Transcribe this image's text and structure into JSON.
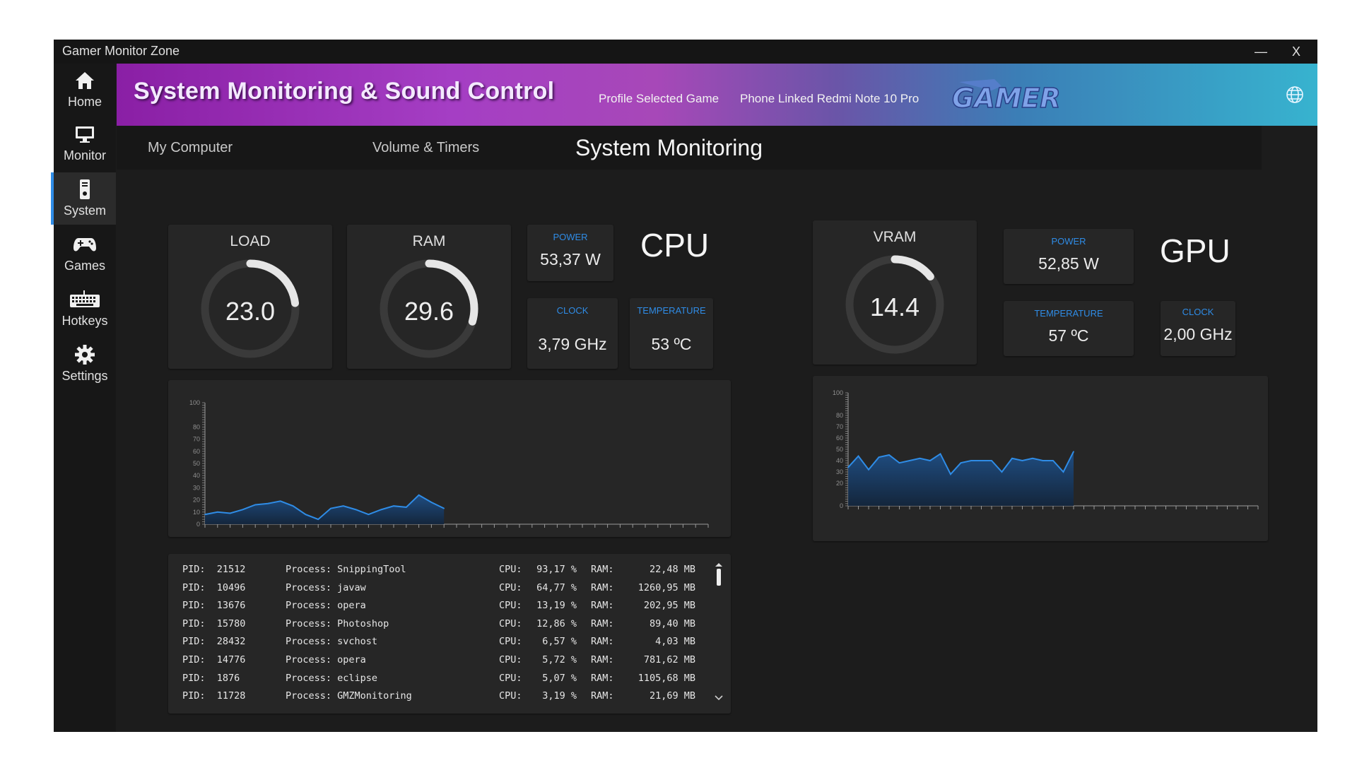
{
  "window": {
    "title": "Gamer Monitor Zone",
    "minimize": "—",
    "close": "X"
  },
  "sidebar": {
    "items": [
      {
        "label": "Home",
        "icon": "home-icon"
      },
      {
        "label": "Monitor",
        "icon": "monitor-icon"
      },
      {
        "label": "System",
        "icon": "system-icon",
        "active": true
      },
      {
        "label": "Games",
        "icon": "gamepad-icon"
      },
      {
        "label": "Hotkeys",
        "icon": "keyboard-icon"
      },
      {
        "label": "Settings",
        "icon": "gear-icon"
      }
    ]
  },
  "banner": {
    "heading": "System Monitoring & Sound Control",
    "profile": "Profile Selected Game",
    "phone": "Phone Linked Redmi Note 10 Pro",
    "logo_text": "GAMER"
  },
  "tabs": [
    {
      "label": "My Computer"
    },
    {
      "label": "Volume & Timers"
    },
    {
      "label": "System Monitoring",
      "active": true
    }
  ],
  "cpu": {
    "label": "CPU",
    "load": {
      "title": "LOAD",
      "value": "23.0",
      "fraction": 0.23
    },
    "ram": {
      "title": "RAM",
      "value": "29.6",
      "fraction": 0.296
    },
    "power": {
      "label": "POWER",
      "value": "53,37 W"
    },
    "clock": {
      "label": "CLOCK",
      "value": "3,79 GHz"
    },
    "temperature": {
      "label": "TEMPERATURE",
      "value": "53 ºC"
    }
  },
  "gpu": {
    "label": "GPU",
    "vram": {
      "title": "VRAM",
      "value": "14.4",
      "fraction": 0.144
    },
    "power": {
      "label": "POWER",
      "value": "52,85 W"
    },
    "temperature": {
      "label": "TEMPERATURE",
      "value": "57 ºC"
    },
    "clock": {
      "label": "CLOCK",
      "value": "2,00 GHz"
    }
  },
  "chart_data": [
    {
      "type": "area",
      "y_ticks": [
        "100",
        "80",
        "70",
        "60",
        "50",
        "40",
        "30",
        "20",
        "10",
        "0"
      ],
      "ylim": [
        0,
        100
      ],
      "xlim": [
        0,
        100
      ],
      "x": [
        0,
        2.5,
        5,
        7.5,
        10,
        12.5,
        15,
        17.5,
        20,
        22.5,
        25,
        27.5,
        30,
        32.5,
        35,
        37.5,
        40,
        42.5,
        45,
        47.5,
        50,
        52.5,
        55,
        57.5,
        60,
        62.5,
        65,
        67.5,
        70,
        72.5,
        75,
        77.5,
        80,
        82.5,
        85,
        87.5,
        90,
        92.5,
        95,
        97.5,
        100
      ],
      "values": [
        8,
        10,
        9,
        12,
        16,
        17,
        19,
        15,
        8,
        4,
        13,
        15,
        12,
        8,
        12,
        15,
        14,
        24,
        18,
        13,
        null,
        null,
        null,
        null,
        null,
        null,
        null,
        null,
        null,
        null,
        null,
        null,
        null,
        null,
        null,
        null,
        null,
        null,
        null,
        null,
        null
      ],
      "color": "#2f8ce6"
    },
    {
      "type": "area",
      "y_ticks": [
        "100",
        "80",
        "70",
        "60",
        "50",
        "40",
        "30",
        "20",
        "0"
      ],
      "ylim": [
        0,
        100
      ],
      "xlim": [
        0,
        100
      ],
      "x": [
        0,
        2.5,
        5,
        7.5,
        10,
        12.5,
        15,
        17.5,
        20,
        22.5,
        25,
        27.5,
        30,
        32.5,
        35,
        37.5,
        40,
        42.5,
        45,
        47.5,
        50,
        52.5,
        55,
        57.5,
        60,
        62.5,
        65,
        67.5,
        70,
        72.5,
        75,
        77.5,
        80,
        82.5,
        85,
        87.5,
        90,
        92.5,
        95,
        97.5,
        100
      ],
      "values": [
        34,
        44,
        32,
        43,
        45,
        38,
        40,
        42,
        40,
        46,
        28,
        38,
        40,
        40,
        40,
        30,
        42,
        40,
        42,
        40,
        40,
        30,
        48,
        null,
        null,
        null,
        null,
        null,
        null,
        null,
        null,
        null,
        null,
        null,
        null,
        null,
        null,
        null,
        null,
        null,
        null
      ],
      "color": "#2f8ce6"
    }
  ],
  "processes": [
    {
      "pid": "PID:  21512",
      "process": "Process: SnippingTool",
      "cpu_label": "CPU:",
      "cpu": "93,17 %",
      "ram_label": "RAM:",
      "ram": "22,48 MB"
    },
    {
      "pid": "PID:  10496",
      "process": "Process: javaw",
      "cpu_label": "CPU:",
      "cpu": "64,77 %",
      "ram_label": "RAM:",
      "ram": "1260,95 MB"
    },
    {
      "pid": "PID:  13676",
      "process": "Process: opera",
      "cpu_label": "CPU:",
      "cpu": "13,19 %",
      "ram_label": "RAM:",
      "ram": "202,95 MB"
    },
    {
      "pid": "PID:  15780",
      "process": "Process: Photoshop",
      "cpu_label": "CPU:",
      "cpu": "12,86 %",
      "ram_label": "RAM:",
      "ram": "89,40 MB"
    },
    {
      "pid": "PID:  28432",
      "process": "Process: svchost",
      "cpu_label": "CPU:",
      "cpu": "6,57 %",
      "ram_label": "RAM:",
      "ram": "4,03 MB"
    },
    {
      "pid": "PID:  14776",
      "process": "Process: opera",
      "cpu_label": "CPU:",
      "cpu": "5,72 %",
      "ram_label": "RAM:",
      "ram": "781,62 MB"
    },
    {
      "pid": "PID:  1876",
      "process": "Process: eclipse",
      "cpu_label": "CPU:",
      "cpu": "5,07 %",
      "ram_label": "RAM:",
      "ram": "1105,68 MB"
    },
    {
      "pid": "PID:  11728",
      "process": "Process: GMZMonitoring",
      "cpu_label": "CPU:",
      "cpu": "3,19 %",
      "ram_label": "RAM:",
      "ram": "21,69 MB"
    }
  ],
  "colors": {
    "accent": "#2f8ce6",
    "gauge_track": "#3a3a3a",
    "gauge_fill": "#e6e6e6",
    "background": "#1c1c1c",
    "card": "#262626"
  }
}
